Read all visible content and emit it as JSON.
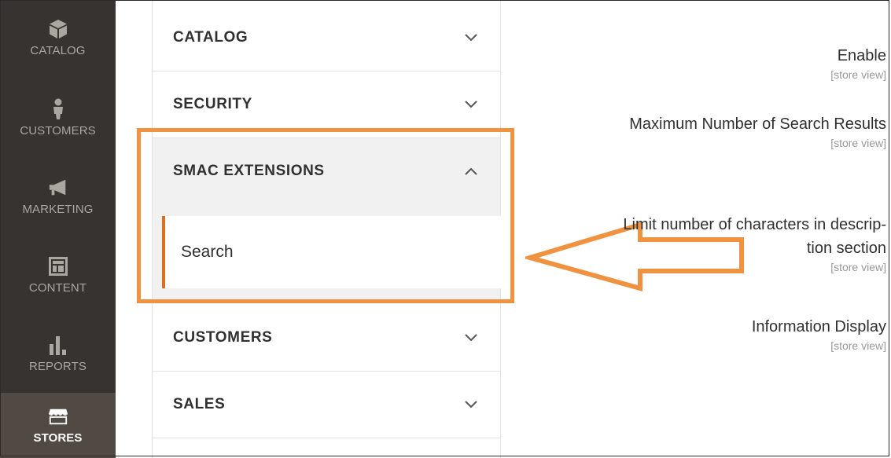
{
  "admin_menu": {
    "items": [
      {
        "label": "CATALOG",
        "icon": "cube-icon"
      },
      {
        "label": "CUSTOMERS",
        "icon": "person-icon"
      },
      {
        "label": "MARKETING",
        "icon": "megaphone-icon"
      },
      {
        "label": "CONTENT",
        "icon": "layout-icon"
      },
      {
        "label": "REPORTS",
        "icon": "bar-chart-icon"
      },
      {
        "label": "STORES",
        "icon": "storefront-icon"
      }
    ],
    "active": "STORES"
  },
  "config_nav": {
    "sections": [
      {
        "title": "CATALOG",
        "state": "collapsed"
      },
      {
        "title": "SECURITY",
        "state": "collapsed"
      },
      {
        "title": "SMAC EXTENSIONS",
        "state": "expanded"
      },
      {
        "title": "CUSTOMERS",
        "state": "collapsed"
      },
      {
        "title": "SALES",
        "state": "collapsed"
      }
    ],
    "sub_item": {
      "label": "Search"
    }
  },
  "fields": [
    {
      "label": "Enable",
      "scope": "[store view]"
    },
    {
      "label": "Maximum Number of Search Results",
      "scope": "[store view]"
    },
    {
      "label_line1": "Limit number of characters in descrip-",
      "label_line2": "tion section",
      "scope": "[store view]"
    },
    {
      "label": "Information Display",
      "scope": "[store view]"
    }
  ],
  "colors": {
    "menu_bg": "#373330",
    "menu_active_bg": "#514943",
    "accent_orange": "#e26c1f",
    "highlight_orange": "#f0923f"
  }
}
